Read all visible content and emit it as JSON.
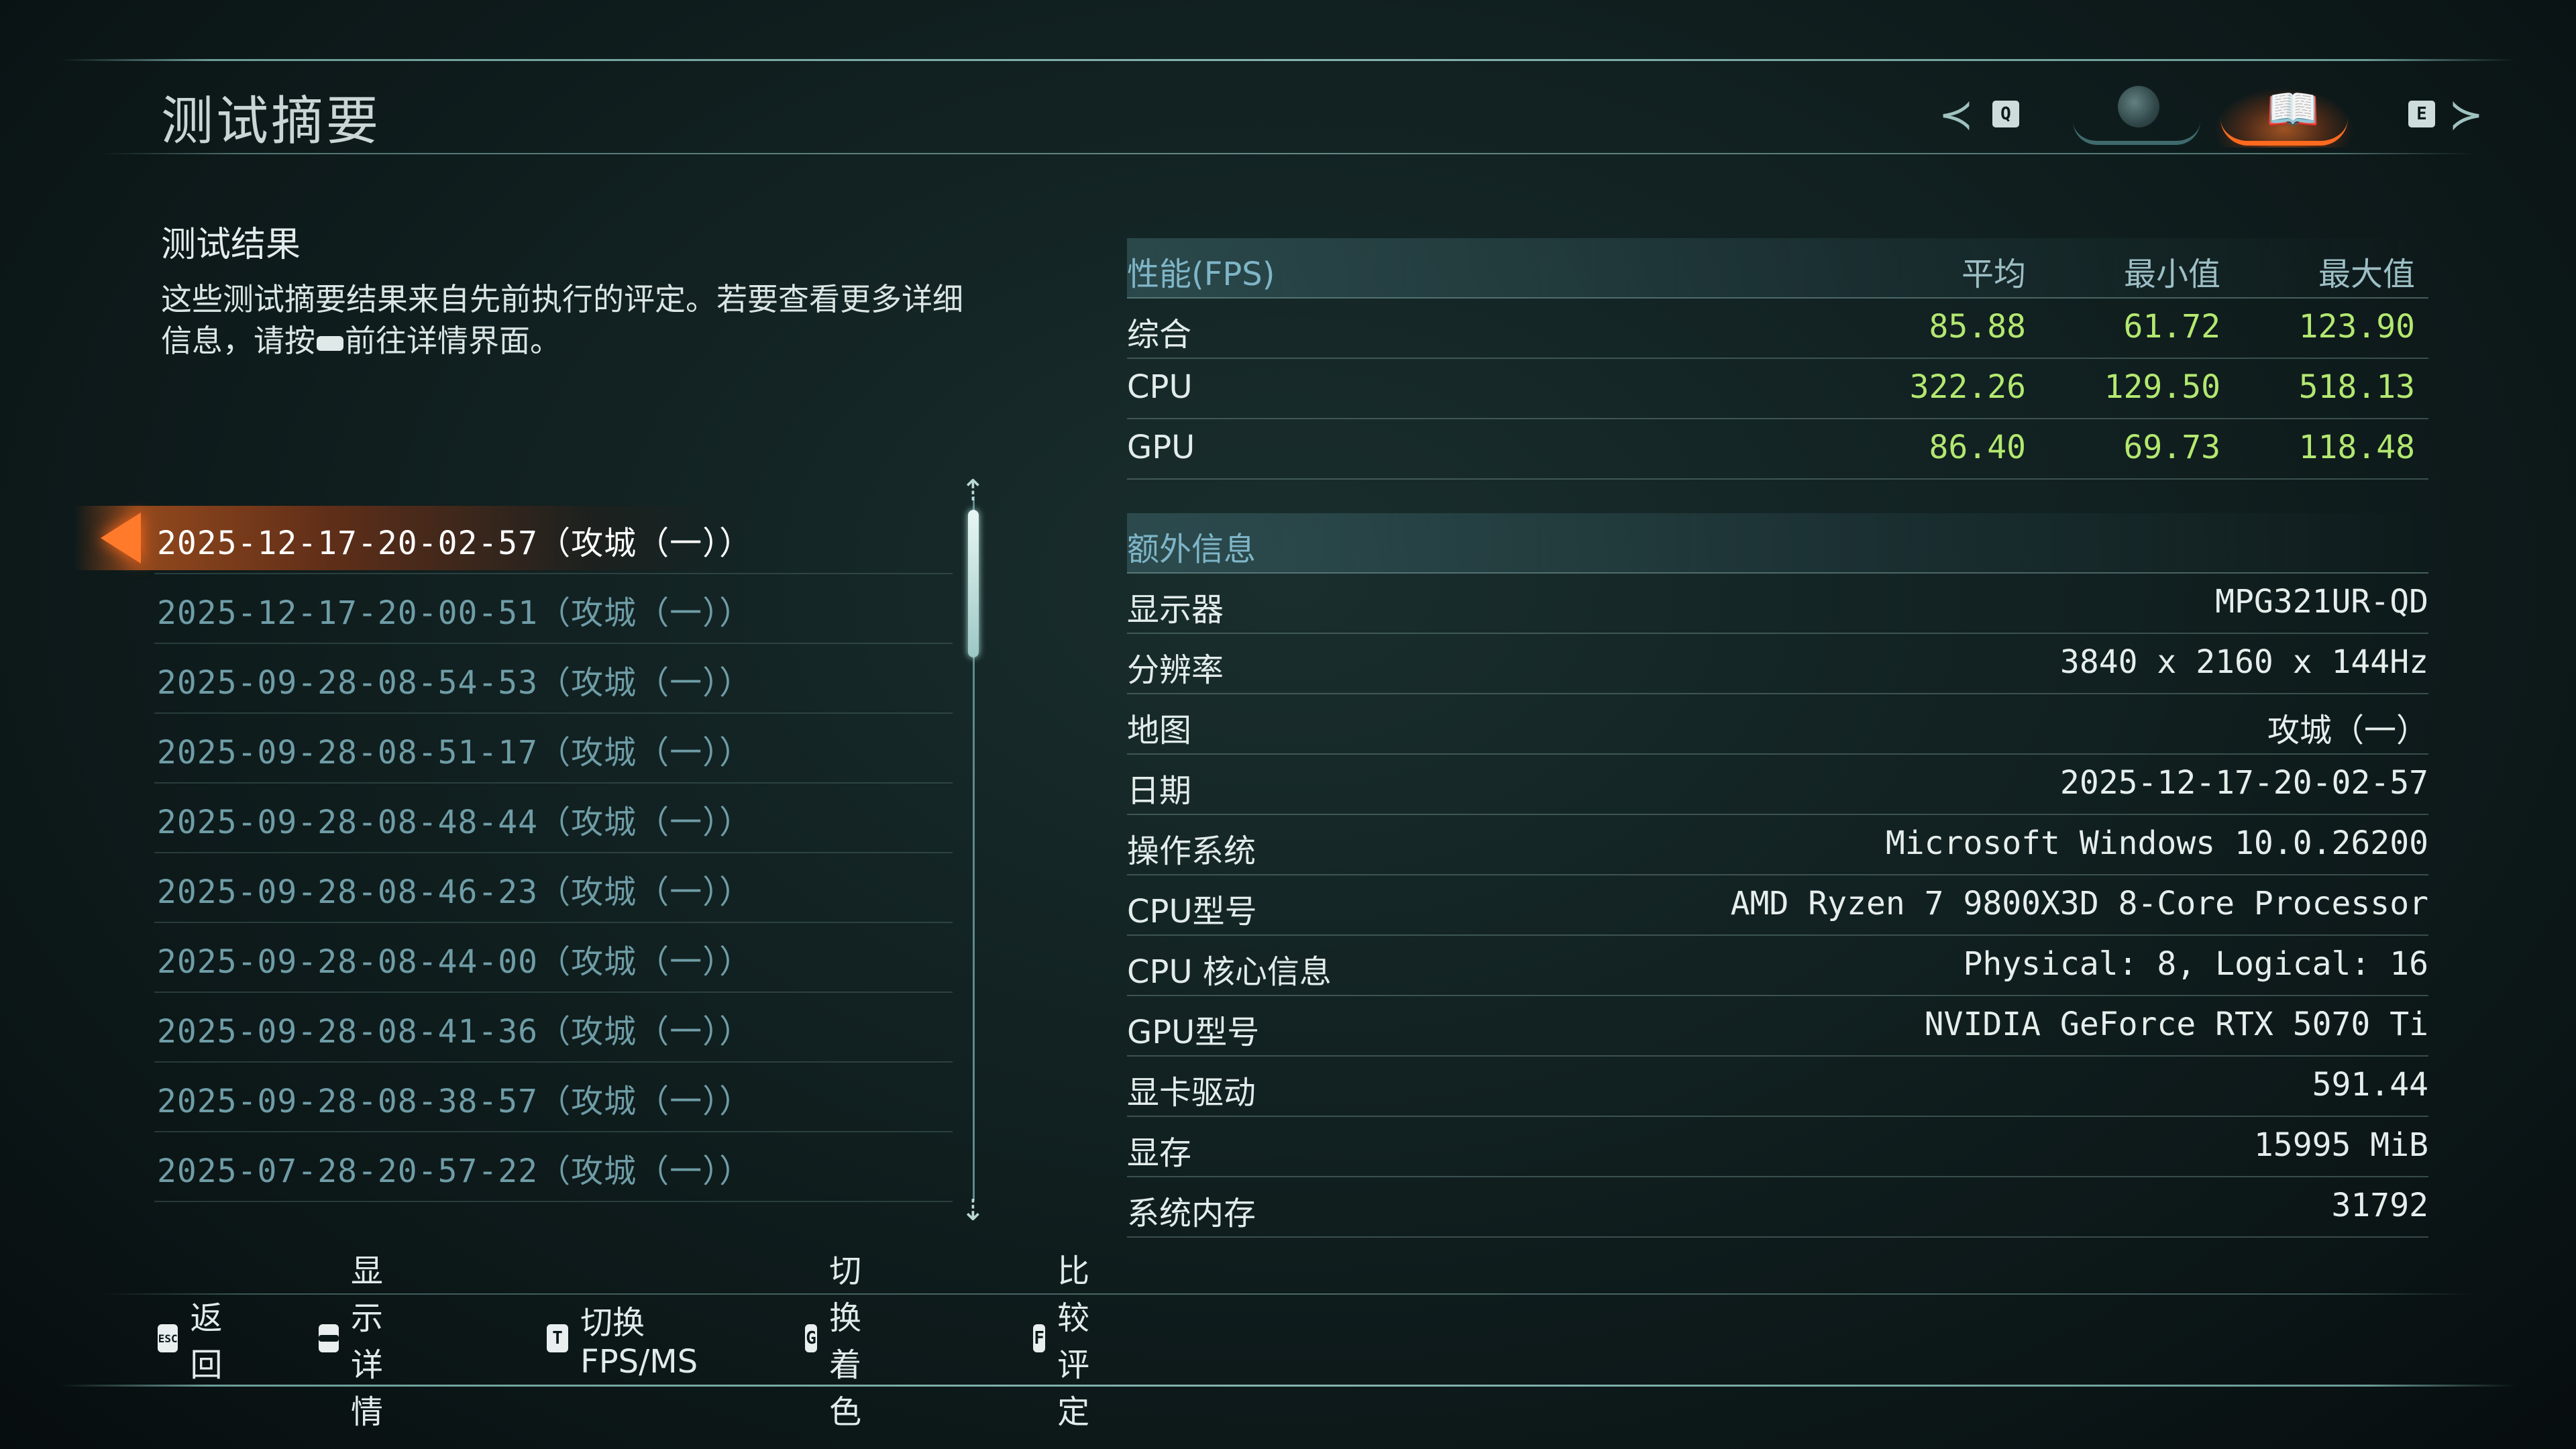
{
  "page_title": "测试摘要",
  "nav": {
    "left_key": "Q",
    "right_key": "E",
    "tabs": [
      "globe-icon",
      "book-icon"
    ]
  },
  "results": {
    "heading": "测试结果",
    "desc_before": "这些测试摘要结果来自先前执行的评定。若要查看更多详细信息，请按",
    "desc_after": "前往详情界面。"
  },
  "runs": [
    "2025-12-17-20-02-57（攻城（一））",
    "2025-12-17-20-00-51（攻城（一））",
    "2025-09-28-08-54-53（攻城（一））",
    "2025-09-28-08-51-17（攻城（一））",
    "2025-09-28-08-48-44（攻城（一））",
    "2025-09-28-08-46-23（攻城（一））",
    "2025-09-28-08-44-00（攻城（一））",
    "2025-09-28-08-41-36（攻城（一））",
    "2025-09-28-08-38-57（攻城（一））",
    "2025-07-28-20-57-22（攻城（一））"
  ],
  "performance": {
    "header": [
      "性能(FPS)",
      "平均",
      "最小值",
      "最大值"
    ],
    "rows": [
      {
        "label": "综合",
        "avg": "85.88",
        "min": "61.72",
        "max": "123.90"
      },
      {
        "label": "CPU",
        "avg": "322.26",
        "min": "129.50",
        "max": "518.13"
      },
      {
        "label": "GPU",
        "avg": "86.40",
        "min": "69.73",
        "max": "118.48"
      }
    ]
  },
  "extra": {
    "header": "额外信息",
    "rows": [
      {
        "label": "显示器",
        "value": "MPG321UR-QD"
      },
      {
        "label": "分辨率",
        "value": "3840 x 2160 x 144Hz"
      },
      {
        "label": "地图",
        "value": "攻城（一）"
      },
      {
        "label": "日期",
        "value": "2025-12-17-20-02-57"
      },
      {
        "label": "操作系统",
        "value": "Microsoft Windows 10.0.26200"
      },
      {
        "label": "CPU型号",
        "value": "AMD Ryzen 7 9800X3D 8-Core Processor"
      },
      {
        "label": "CPU 核心信息",
        "value": "Physical: 8, Logical: 16"
      },
      {
        "label": "GPU型号",
        "value": "NVIDIA GeForce RTX 5070 Ti"
      },
      {
        "label": "显卡驱动",
        "value": "591.44"
      },
      {
        "label": "显存",
        "value": "15995 MiB"
      },
      {
        "label": "系统内存",
        "value": "31792"
      }
    ]
  },
  "footer": [
    {
      "key": "ESC",
      "label": "返回"
    },
    {
      "key": "",
      "label": "显示详情"
    },
    {
      "key": "T",
      "label": "切换FPS/MS"
    },
    {
      "key": "G",
      "label": "切换着色"
    },
    {
      "key": "F",
      "label": "比较评定"
    }
  ]
}
